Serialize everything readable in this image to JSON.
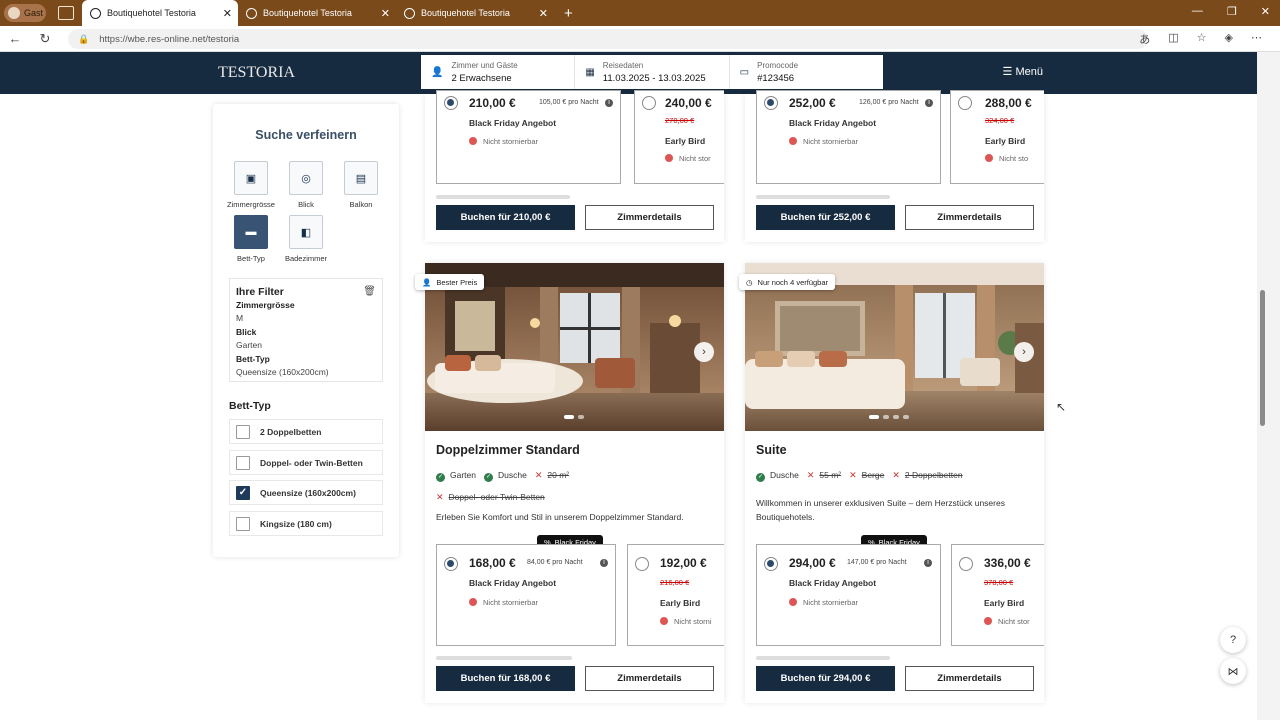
{
  "browser": {
    "guest_label": "Gast",
    "tabs": [
      {
        "title": "Boutiquehotel Testoria",
        "active": true
      },
      {
        "title": "Boutiquehotel Testoria",
        "active": false
      },
      {
        "title": "Boutiquehotel Testoria",
        "active": false
      }
    ],
    "url": "https://wbe.res-online.net/testoria"
  },
  "header": {
    "logo": "TESTORIA",
    "guests_label": "Zimmer und Gäste",
    "guests_value": "2 Erwachsene",
    "dates_label": "Reisedaten",
    "dates_value": "11.03.2025 - 13.03.2025",
    "promo_label": "Promocode",
    "promo_value": "#123456",
    "menu_label": "Menü"
  },
  "sidebar": {
    "title": "Suche verfeinern",
    "filters": [
      {
        "label": "Zimmergrösse",
        "icon": "ruler-icon",
        "selected": false
      },
      {
        "label": "Blick",
        "icon": "binoculars-icon",
        "selected": false
      },
      {
        "label": "Balkon",
        "icon": "balcony-icon",
        "selected": false
      },
      {
        "label": "Bett-Typ",
        "icon": "bed-icon",
        "selected": true
      },
      {
        "label": "Badezimmer",
        "icon": "bath-icon",
        "selected": false
      }
    ],
    "your_filters_title": "Ihre Filter",
    "your_filters": [
      {
        "k": "Zimmergrösse",
        "v": "M"
      },
      {
        "k": "Blick",
        "v": "Garten"
      },
      {
        "k": "Bett-Typ",
        "v": "Queensize (160x200cm)"
      }
    ],
    "bett_typ_title": "Bett-Typ",
    "bett_options": [
      {
        "label": "2 Doppelbetten",
        "checked": false
      },
      {
        "label": "Doppel- oder Twin-Betten",
        "checked": false
      },
      {
        "label": "Queensize (160x200cm)",
        "checked": true
      },
      {
        "label": "Kingsize (180 cm)",
        "checked": false
      }
    ]
  },
  "top_cards": [
    {
      "rate1": {
        "price": "210,00 €",
        "per_night": "105,00 € pro Nacht",
        "name": "Black Friday Angebot",
        "note": "Nicht stornierbar"
      },
      "rate2": {
        "price": "240,00 €",
        "old": "270,00 €",
        "name": "Early Bird",
        "note": "Nicht stor"
      },
      "book": "Buchen für 210,00 €",
      "details": "Zimmerdetails"
    },
    {
      "rate1": {
        "price": "252,00 €",
        "per_night": "126,00 € pro Nacht",
        "name": "Black Friday Angebot",
        "note": "Nicht stornierbar"
      },
      "rate2": {
        "price": "288,00 €",
        "old": "324,00 €",
        "name": "Early Bird",
        "note": "Nicht sto"
      },
      "book": "Buchen für 252,00 €",
      "details": "Zimmerdetails"
    }
  ],
  "rooms": [
    {
      "badge": "Bester Preis",
      "title": "Doppelzimmer Standard",
      "features_ok": [
        "Garten",
        "Dusche"
      ],
      "features_no": [
        "20 m²",
        "Doppel- oder Twin-Betten"
      ],
      "description": "Erleben Sie Komfort und Stil in unserem Doppelzimmer Standard.",
      "bf_badge": "Black Friday",
      "rate1": {
        "price": "168,00 €",
        "per_night": "84,00 € pro Nacht",
        "name": "Black Friday Angebot",
        "note": "Nicht stornierbar"
      },
      "rate2": {
        "price": "192,00 €",
        "old": "216,00 €",
        "name": "Early Bird",
        "note": "Nicht storni"
      },
      "book": "Buchen für 168,00 €",
      "details": "Zimmerdetails"
    },
    {
      "badge": "Nur noch 4 verfügbar",
      "title": "Suite",
      "features_ok": [
        "Dusche"
      ],
      "features_no": [
        "55 m²",
        "Berge",
        "2 Doppelbetten"
      ],
      "description": "Willkommen in unserer exklusiven Suite – dem Herzstück unseres Boutiquehotels.",
      "bf_badge": "Black Friday",
      "rate1": {
        "price": "294,00 €",
        "per_night": "147,00 € pro Nacht",
        "name": "Black Friday Angebot",
        "note": "Nicht stornierbar"
      },
      "rate2": {
        "price": "336,00 €",
        "old": "378,00 €",
        "name": "Early Bird",
        "note": "Nicht stor"
      },
      "book": "Buchen für 294,00 €",
      "details": "Zimmerdetails"
    }
  ]
}
